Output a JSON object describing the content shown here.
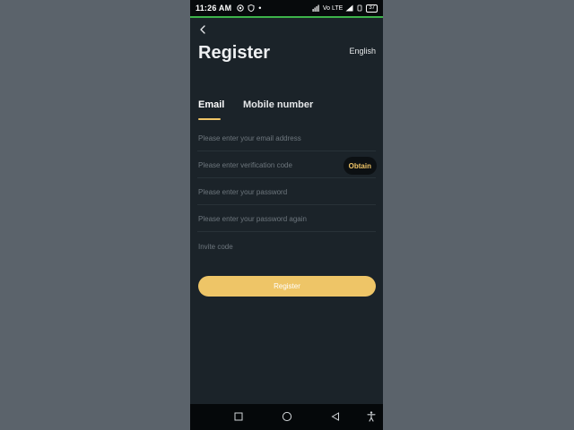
{
  "status_bar": {
    "time": "11:26 AM",
    "dot": "•",
    "signal_text": "Vo LTE",
    "battery": "37"
  },
  "header": {
    "title": "Register",
    "language": "English"
  },
  "tabs": [
    {
      "label": "Email",
      "active": true
    },
    {
      "label": "Mobile number",
      "active": false
    }
  ],
  "form": {
    "email_placeholder": "Please enter your email address",
    "code_placeholder": "Please enter verification code",
    "obtain_label": "Obtain",
    "password_placeholder": "Please enter your password",
    "password_again_placeholder": "Please enter your password again",
    "invite_placeholder": "Invite code",
    "register_label": "Register"
  },
  "nav_icons": [
    "recents-icon",
    "home-icon",
    "back-triangle-icon",
    "accessibility-icon"
  ],
  "colors": {
    "accent": "#eec567",
    "background": "#1b2329",
    "status_accent": "#3db34a"
  }
}
